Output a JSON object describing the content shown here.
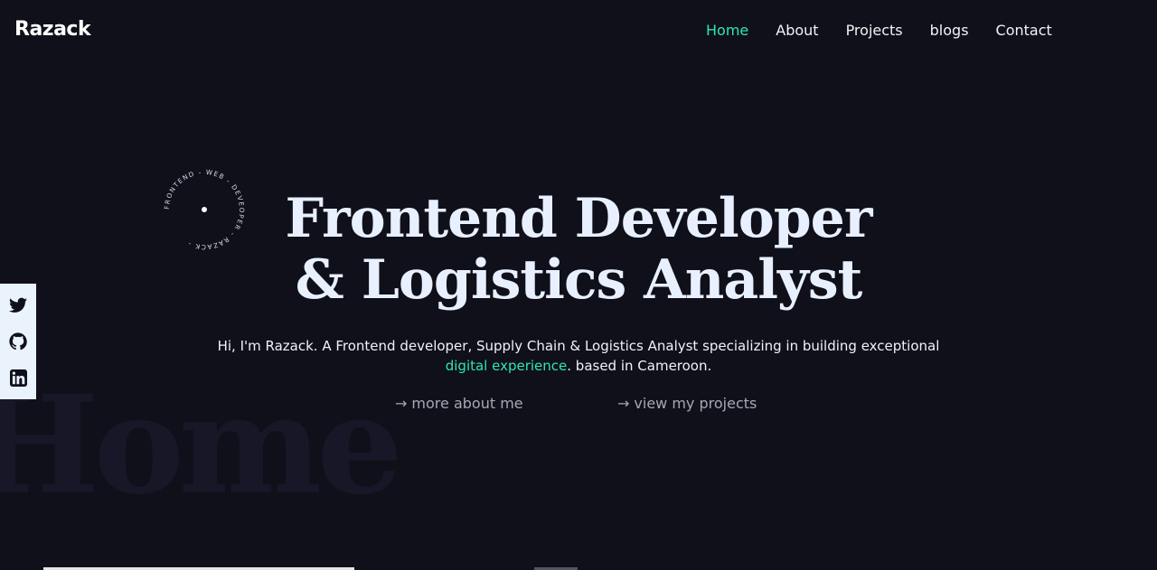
{
  "brand": "Razack",
  "nav": {
    "items": [
      {
        "label": "Home"
      },
      {
        "label": "About"
      },
      {
        "label": "Projects"
      },
      {
        "label": "blogs"
      },
      {
        "label": "Contact"
      }
    ],
    "active_color": "#2ee6b0"
  },
  "badge": {
    "circular_text": "FRONTEND - WEB - DEVEOPER - RAZACK -"
  },
  "hero": {
    "title_line1": "Frontend Developer",
    "title_line2": "& Logistics Analyst",
    "subtitle_part1": "Hi, I'm Razack. A Frontend developer, Supply Chain & Logistics Analyst specializing in building exceptional ",
    "subtitle_accent": "digital experience",
    "subtitle_part2": ". based in Cameroon."
  },
  "cta": {
    "arrow": "→",
    "about_label": "more about me",
    "projects_label": "view my projects"
  },
  "watermark": "Home",
  "social": [
    "twitter-icon",
    "github-icon",
    "linkedin-icon"
  ]
}
